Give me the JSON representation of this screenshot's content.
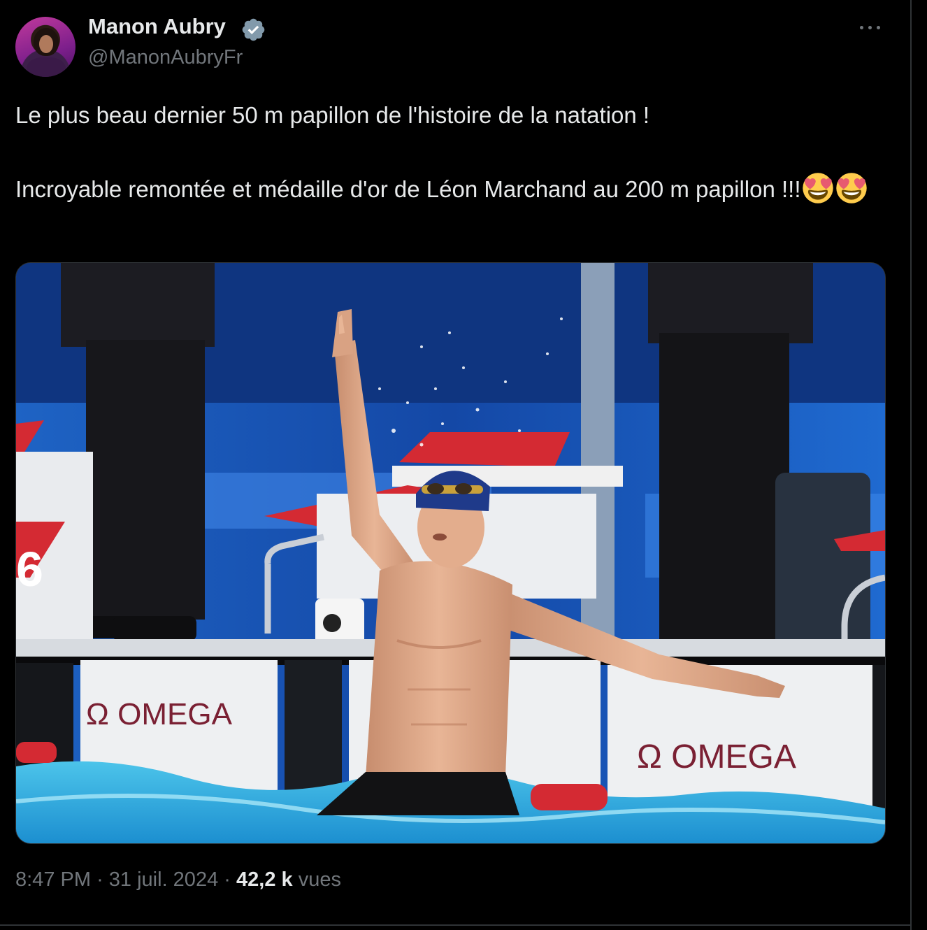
{
  "author": {
    "name": "Manon Aubry",
    "handle": "@ManonAubryFr",
    "verified": true,
    "avatar_icon": "profile-photo"
  },
  "menu_icon": "more-dots-icon",
  "tweet": {
    "line1": "Le plus beau dernier 50 m papillon de l'histoire de la natation !",
    "line2": "Incroyable remontée et médaille d'or de Léon Marchand au 200 m papillon !!!",
    "emojis": [
      "heart-eyes-emoji",
      "heart-eyes-emoji"
    ]
  },
  "media": {
    "description_icon": "photo",
    "lane_number": "6",
    "brand_left": "Ω OMEGA",
    "brand_right": "Ω OMEGA"
  },
  "meta": {
    "time": "8:47 PM",
    "separator": "·",
    "date": "31 juil. 2024",
    "views_count": "42,2 k",
    "views_label": "vues"
  },
  "colors": {
    "background": "#000000",
    "text": "#e7e9ea",
    "secondary": "#71767b",
    "verified": "#829aab"
  }
}
